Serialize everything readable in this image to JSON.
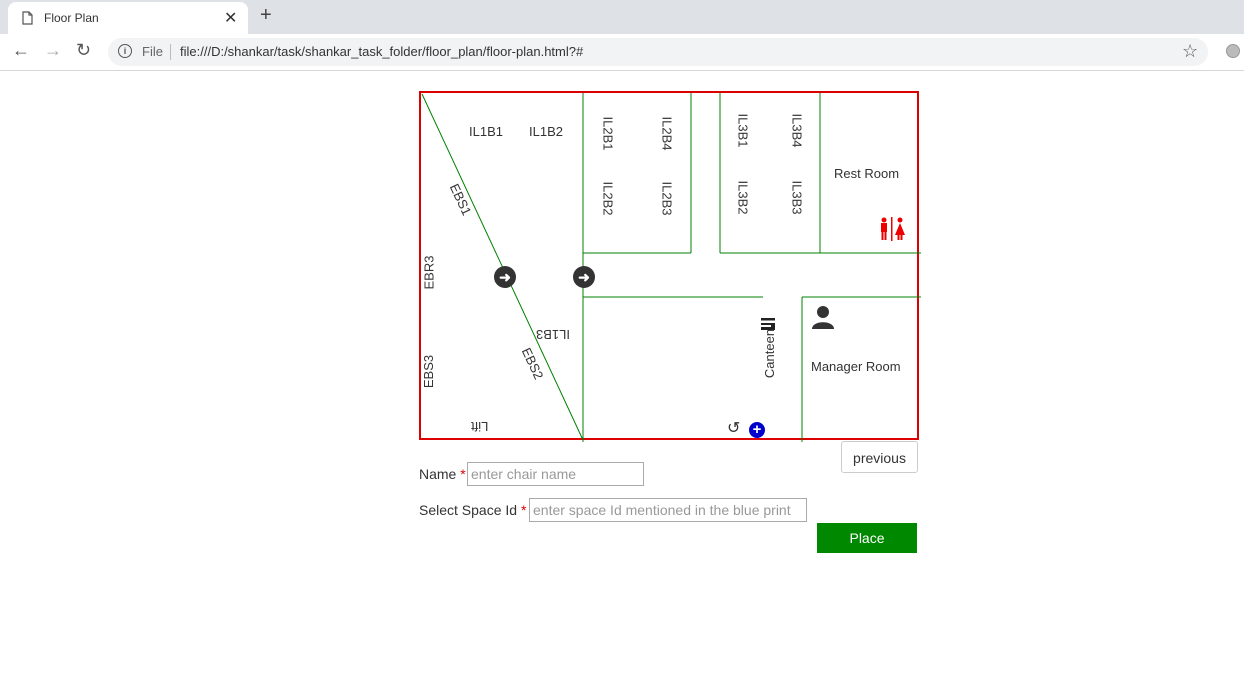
{
  "browser": {
    "tab_title": "Floor Plan",
    "file_label": "File",
    "url": "file:///D:/shankar/task/shankar_task_folder/floor_plan/floor-plan.html?#"
  },
  "floor_plan": {
    "border_color": "#dd0000",
    "wall_color": "#008000",
    "labels": {
      "il1b1": "IL1B1",
      "il1b2": "IL1B2",
      "il2b1": "IL2B1",
      "il2b4": "IL2B4",
      "il2b2": "IL2B2",
      "il2b3": "IL2B3",
      "il3b1": "IL3B1",
      "il3b4": "IL3B4",
      "il3b2": "IL3B2",
      "il3b3": "IL3B3",
      "rest_room": "Rest Room",
      "ebs1": "EBS1",
      "ebs2": "EBS2",
      "ebr3": "EBR3",
      "ebs3": "EBS3",
      "il1b3": "IL1B3",
      "lift": "Lift",
      "canteen": "Canteen",
      "manager_room": "Manager Room"
    },
    "icons": [
      "restroom-icon",
      "arrow-right-icon",
      "person-icon",
      "cutlery-icon",
      "rotate-icon",
      "plus-icon"
    ]
  },
  "form": {
    "previous_label": "previous",
    "name_label": "Name",
    "name_placeholder": "enter chair name",
    "space_label": "Select Space Id",
    "space_placeholder": "enter space Id mentioned in the blue print",
    "required_mark": "*",
    "place_label": "Place"
  }
}
